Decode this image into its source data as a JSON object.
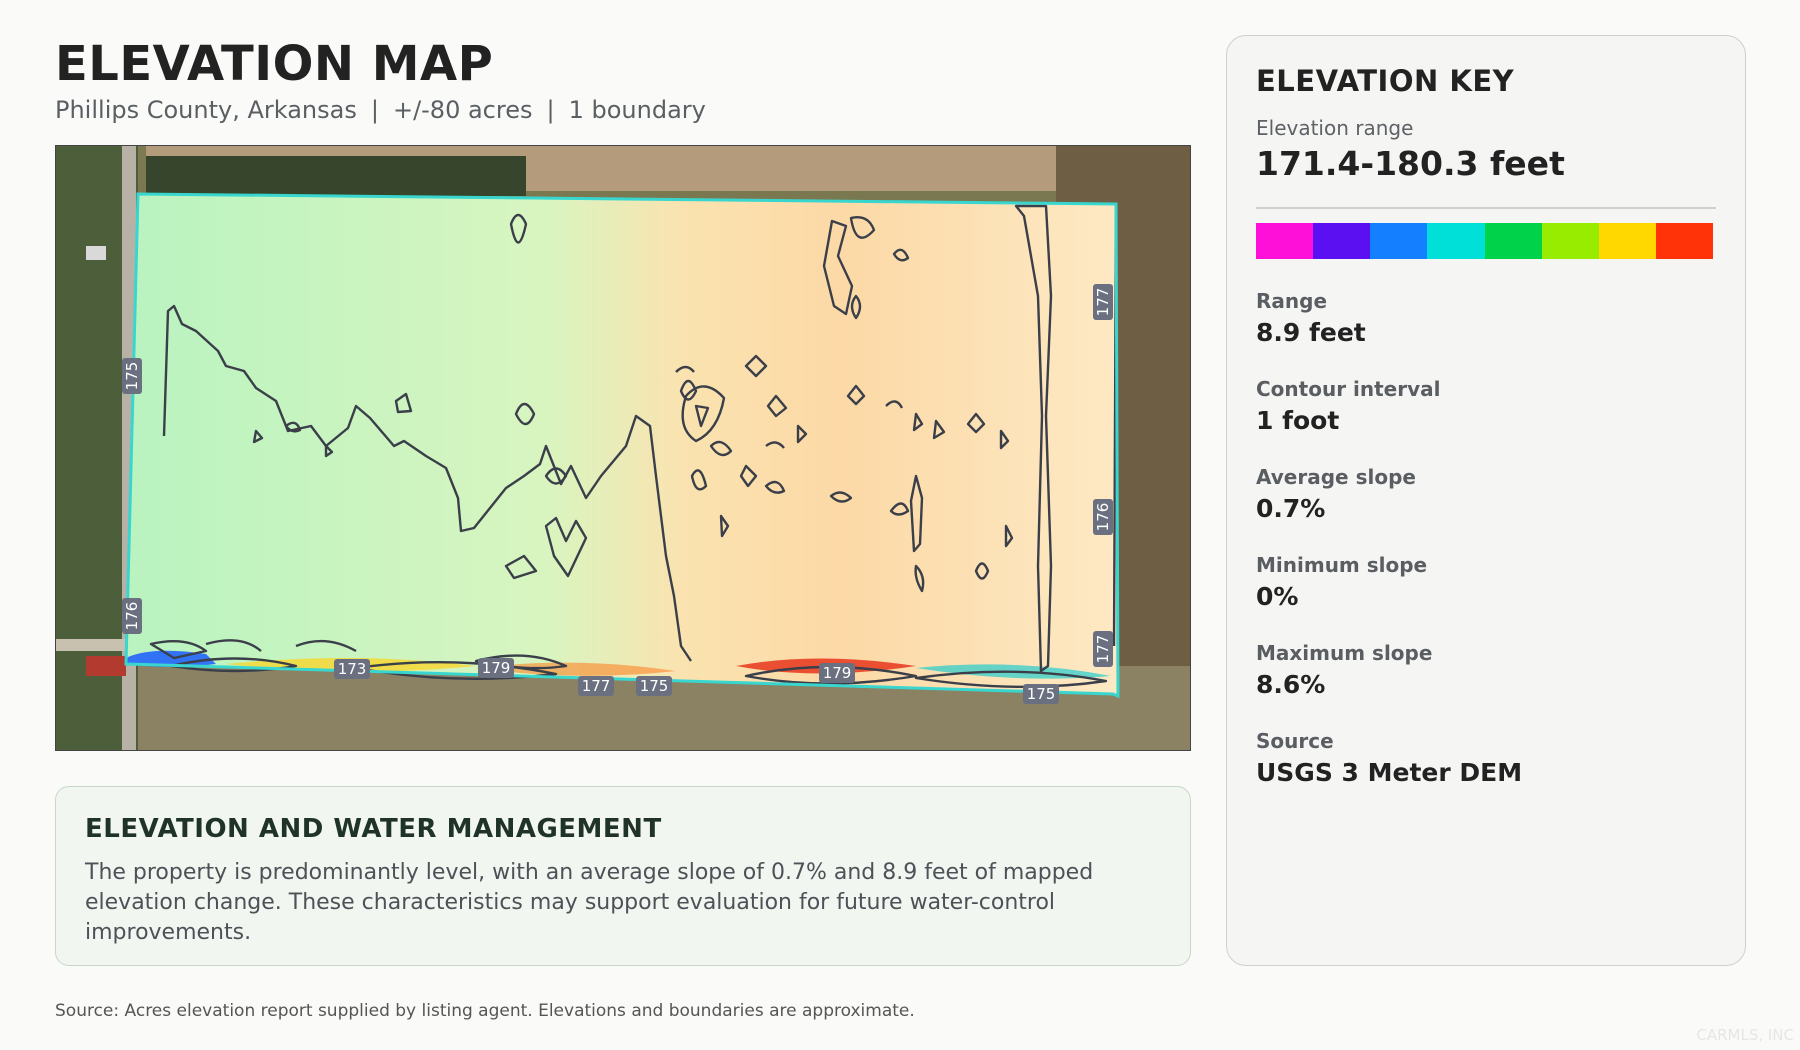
{
  "header": {
    "title": "ELEVATION MAP",
    "location": "Phillips County, Arkansas",
    "acres": "+/-80 acres",
    "boundaries": "1 boundary",
    "separator": "|"
  },
  "map": {
    "contour_labels": [
      "175",
      "176",
      "173",
      "179",
      "177",
      "175",
      "179",
      "175",
      "177",
      "176",
      "177"
    ],
    "colors": {
      "boundary": "#39d6cf",
      "contour": "#3b3f4a",
      "low": "#b9f3c0",
      "high": "#fcd9a6"
    }
  },
  "notes": {
    "title": "ELEVATION AND WATER MANAGEMENT",
    "body": "The property is predominantly level, with an average slope of 0.7% and 8.9 feet of mapped elevation change. These characteristics may support evaluation for future water-control improvements."
  },
  "key": {
    "title": "ELEVATION KEY",
    "range_label": "Elevation range",
    "range_value": "171.4-180.3 feet",
    "ramp_colors": [
      "#ff10d8",
      "#5a10f0",
      "#1580ff",
      "#00e0d8",
      "#00d24a",
      "#98ec00",
      "#ffd800",
      "#ff3208"
    ],
    "stats": [
      {
        "label": "Range",
        "value": "8.9 feet"
      },
      {
        "label": "Contour interval",
        "value": "1 foot"
      },
      {
        "label": "Average slope",
        "value": "0.7%"
      },
      {
        "label": "Minimum slope",
        "value": "0%"
      },
      {
        "label": "Maximum slope",
        "value": "8.6%"
      },
      {
        "label": "Source",
        "value": "USGS 3 Meter DEM"
      }
    ]
  },
  "footer": {
    "source": "Source: Acres elevation report supplied by listing agent. Elevations and boundaries are approximate.",
    "watermark": "CARMLS, INC"
  }
}
